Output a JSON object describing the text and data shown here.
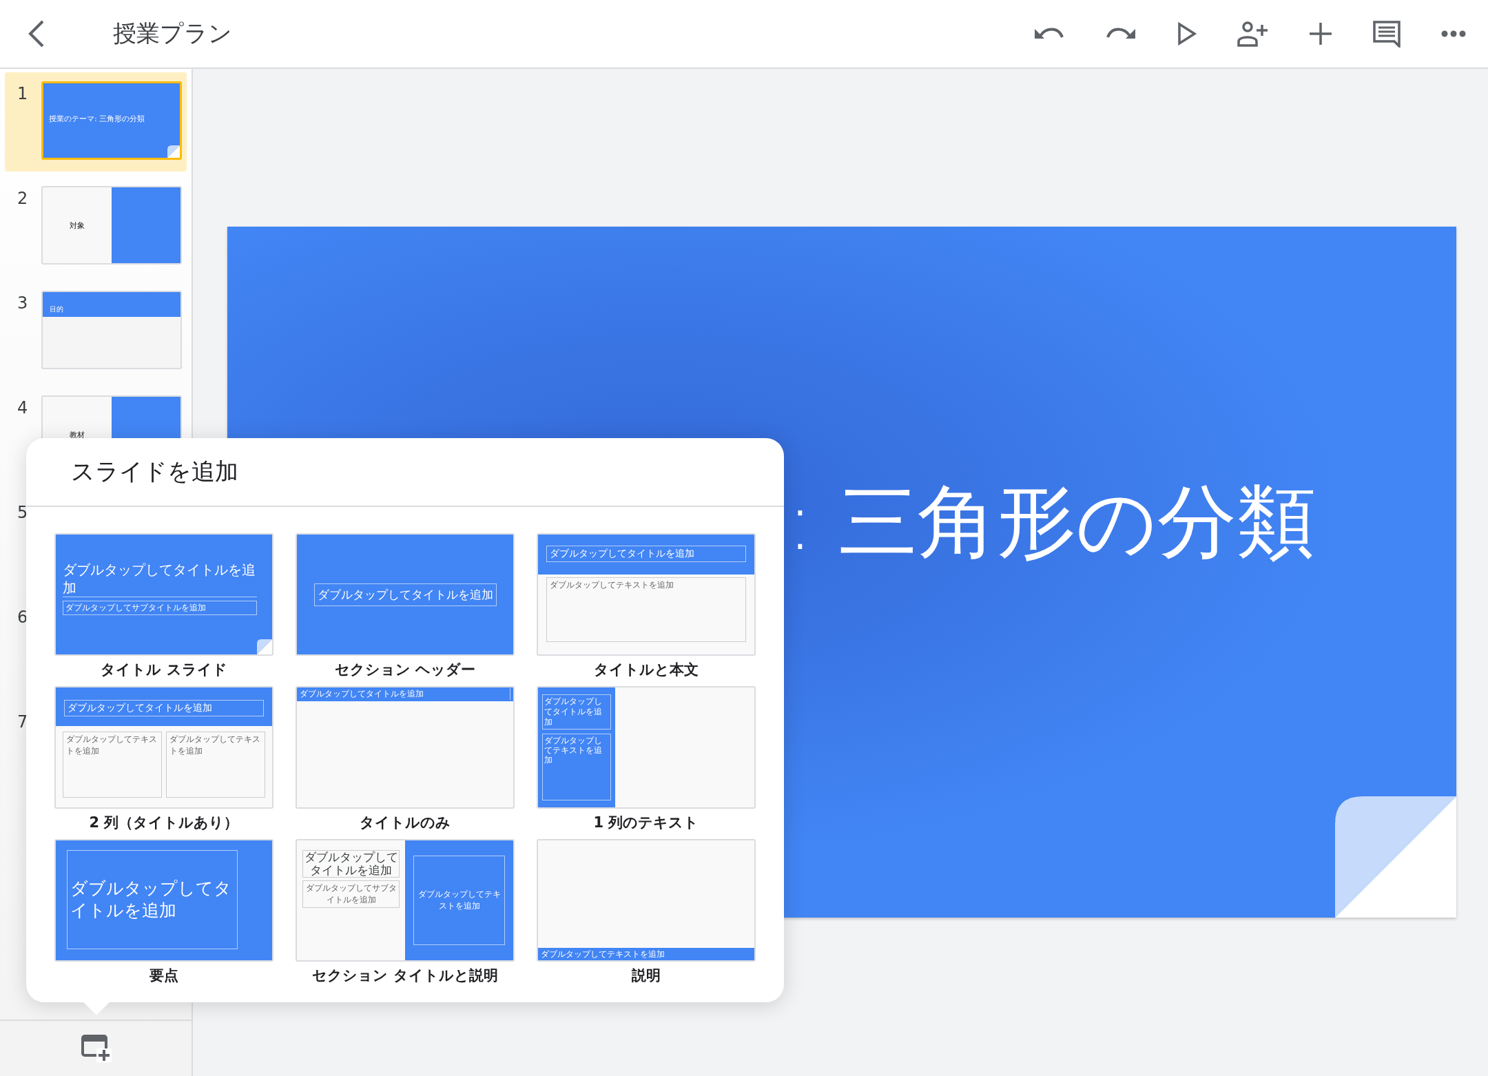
{
  "header": {
    "title": "授業プラン"
  },
  "toolbar": [
    {
      "kind": "undo"
    },
    {
      "kind": "redo"
    },
    {
      "kind": "play"
    },
    {
      "kind": "share"
    },
    {
      "kind": "add"
    },
    {
      "kind": "comment"
    },
    {
      "kind": "more"
    }
  ],
  "slides": [
    {
      "number": "1",
      "selected": true,
      "kind": "title",
      "title": "授業のテーマ: 三角形の分類"
    },
    {
      "number": "2",
      "selected": false,
      "kind": "split",
      "title": "対象"
    },
    {
      "number": "3",
      "selected": false,
      "kind": "header",
      "title": "目的"
    },
    {
      "number": "4",
      "selected": false,
      "kind": "split",
      "title": "教材"
    },
    {
      "number": "5",
      "selected": false
    },
    {
      "number": "6",
      "selected": false
    },
    {
      "number": "7",
      "selected": false
    }
  ],
  "canvas": {
    "title": ": 三角形の分類"
  },
  "add_slide_popup": {
    "title": "スライドを追加",
    "layouts": [
      {
        "kind": "title_slide",
        "label": "タイトル スライド",
        "texts": [
          "ダブルタップしてタイトルを追加",
          "ダブルタップしてサブタイトルを追加"
        ]
      },
      {
        "kind": "section_header",
        "label": "セクション ヘッダー",
        "texts": [
          "ダブルタップしてタイトルを追加"
        ]
      },
      {
        "kind": "title_body",
        "label": "タイトルと本文",
        "texts": [
          "ダブルタップしてタイトルを追加",
          "ダブルタップしてテキストを追加"
        ]
      },
      {
        "kind": "two_columns",
        "label": "2 列（タイトルあり）",
        "texts": [
          "ダブルタップしてタイトルを追加",
          "ダブルタップしてテキストを追加",
          "ダブルタップしてテキストを追加"
        ]
      },
      {
        "kind": "title_only",
        "label": "タイトルのみ",
        "texts": [
          "ダブルタップしてタイトルを追加"
        ]
      },
      {
        "kind": "one_column",
        "label": "1 列のテキスト",
        "texts": [
          "ダブルタップしてタイトルを追加",
          "ダブルタップしてテキストを追加"
        ]
      },
      {
        "kind": "main_point",
        "label": "要点",
        "texts": [
          "ダブルタップしてタイトルを追加"
        ]
      },
      {
        "kind": "section_description",
        "label": "セクション タイトルと説明",
        "texts": [
          "ダブルタップしてタイトルを追加",
          "ダブルタップしてサブタイトルを追加",
          "ダブルタップしてテキストを追加"
        ]
      },
      {
        "kind": "caption",
        "label": "説明",
        "texts": [
          "ダブルタップしてテキストを追加"
        ]
      }
    ]
  }
}
